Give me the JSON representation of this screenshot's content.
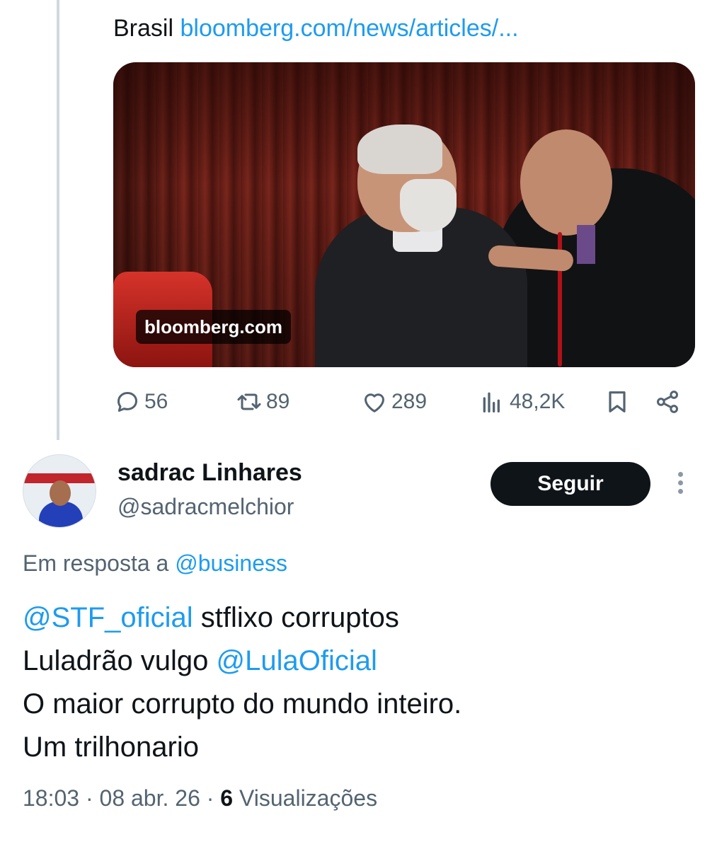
{
  "quoted_card": {
    "link_prefix": "Brasil",
    "link_url": "bloomberg.com/news/articles/...",
    "media_source_badge": "bloomberg.com"
  },
  "actions": {
    "replies": "56",
    "retweets": "89",
    "likes": "289",
    "views": "48,2K",
    "icons": [
      "reply-icon",
      "retweet-icon",
      "like-icon",
      "views-icon",
      "bookmark-icon",
      "share-icon"
    ]
  },
  "reply": {
    "author_name": "sadrac Linhares",
    "author_handle": "@sadracmelchior",
    "follow_label": "Seguir",
    "reply_to_label": "Em resposta a",
    "reply_to_handle": "@business",
    "text": {
      "line1_mention": "@STF_oficial",
      "line1_text": " stflixo corruptos",
      "line2_text": "Luladrão vulgo ",
      "line2_mention": "@LulaOficial",
      "line3_text": "O maior corrupto do mundo inteiro.",
      "line4_text": "Um trilhonario"
    },
    "time": "18:03",
    "date": "08 abr. 26",
    "view_count": "6",
    "views_label": "Visualizações"
  },
  "colors": {
    "link": "#1d9bf0",
    "muted": "#536471",
    "text": "#0f1419",
    "button_bg": "#0f1419"
  }
}
